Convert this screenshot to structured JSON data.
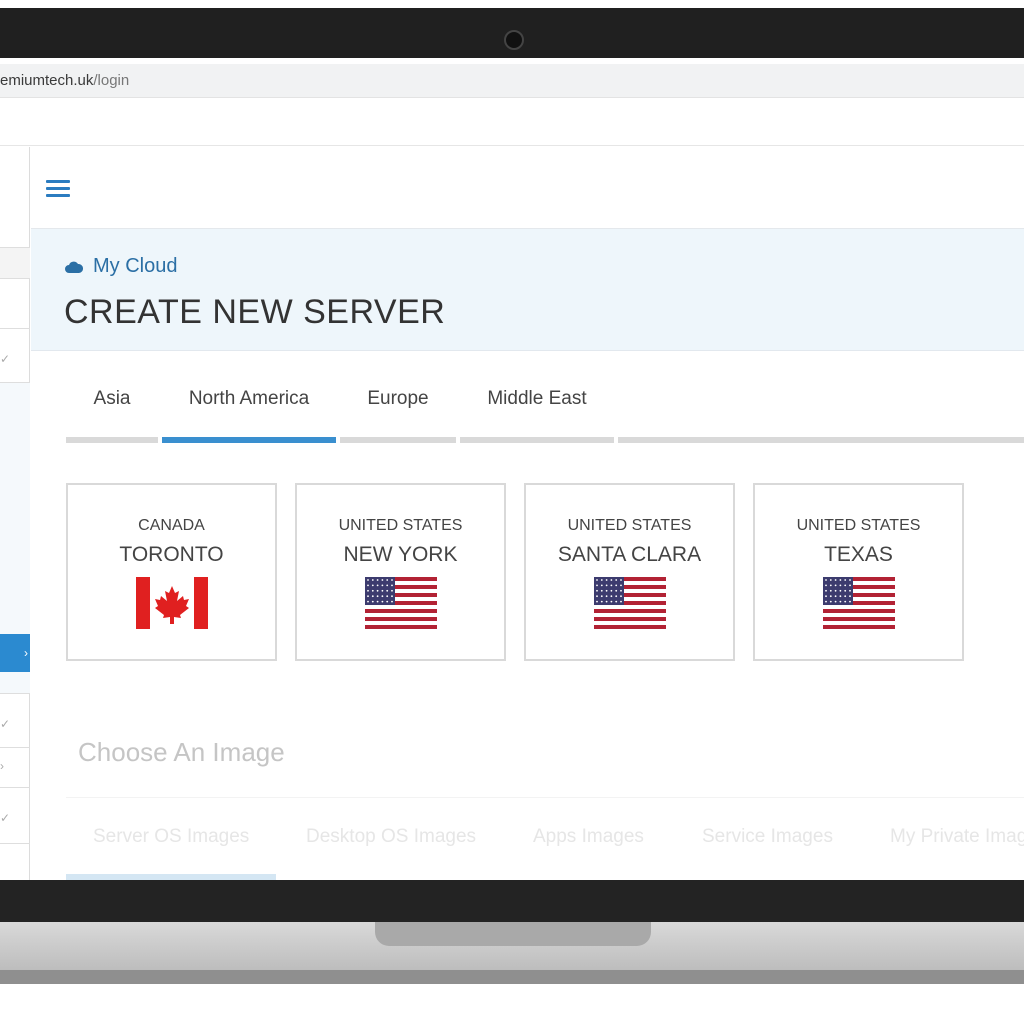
{
  "browser": {
    "url_host": "emiumtech.uk",
    "url_path": "/login"
  },
  "header": {
    "breadcrumb": "My Cloud",
    "title": "CREATE NEW SERVER"
  },
  "region_tabs": [
    {
      "label": "Asia",
      "active": false
    },
    {
      "label": "North America",
      "active": true
    },
    {
      "label": "Europe",
      "active": false
    },
    {
      "label": "Middle East",
      "active": false
    }
  ],
  "locations": [
    {
      "country": "CANADA",
      "city": "TORONTO",
      "flag": "canada-flag"
    },
    {
      "country": "UNITED STATES",
      "city": "NEW YORK",
      "flag": "usa-flag"
    },
    {
      "country": "UNITED STATES",
      "city": "SANTA CLARA",
      "flag": "usa-flag"
    },
    {
      "country": "UNITED STATES",
      "city": "TEXAS",
      "flag": "usa-flag"
    }
  ],
  "image_section": {
    "title": "Choose An Image",
    "tabs": [
      "Server OS Images",
      "Desktop OS Images",
      "Apps Images",
      "Service Images",
      "My Private Imag"
    ]
  },
  "colors": {
    "accent": "#3a8fcf",
    "header_bg": "#eef6fb",
    "canada_red": "#e02020",
    "usa_red": "#b22234",
    "usa_blue": "#3c3b6e"
  },
  "icons": [
    "hamburger-menu-icon",
    "cloud-icon",
    "check-icon",
    "chevron-right-icon"
  ]
}
